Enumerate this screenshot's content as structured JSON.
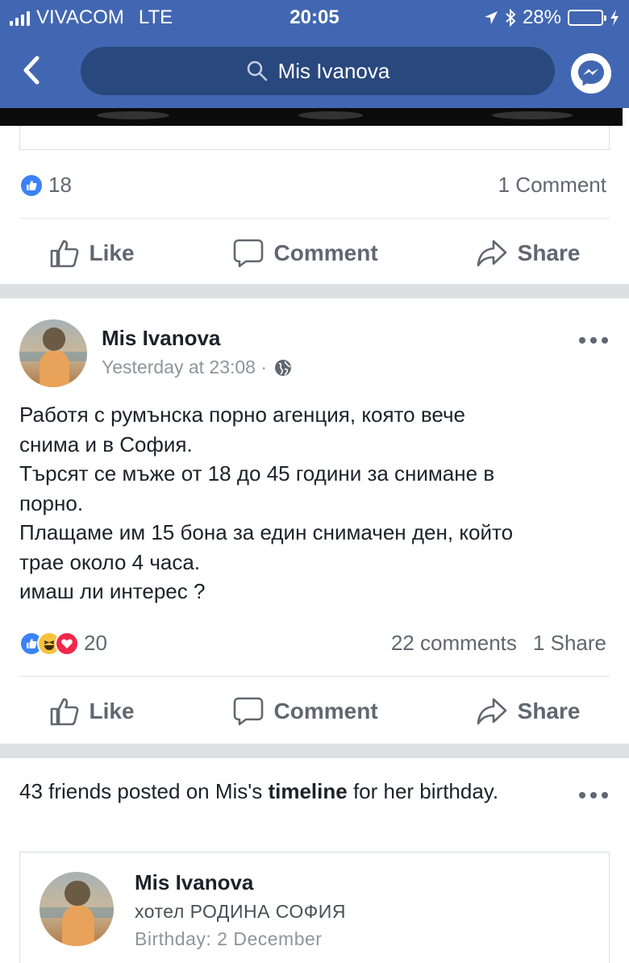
{
  "status_bar": {
    "carrier": "VIVACOM",
    "network": "LTE",
    "time": "20:05",
    "battery": "28%",
    "battery_level": 0.28
  },
  "nav": {
    "search_text": "Mis Ivanova"
  },
  "post1": {
    "reaction_count": "18",
    "comments": "1 Comment"
  },
  "actions": {
    "like": "Like",
    "comment": "Comment",
    "share": "Share"
  },
  "post2": {
    "author": "Mis Ivanova",
    "time": "Yesterday at 23:08 ·",
    "lines": [
      "Работя с румънска порно агенция, която вече",
      "снима и в София.",
      "Търсят се мъже от 18 до 45 години за снимане в",
      "порно.",
      "Плащаме им 15 бона за един снимачен ден, който",
      "трае около 4 часа.",
      "имаш ли интерес ?"
    ],
    "reaction_count": "20",
    "comments": "22 comments",
    "shares": "1 Share"
  },
  "post3": {
    "text_before": "43 friends posted on Mis's ",
    "text_bold": "timeline",
    "text_after": " for her birthday.",
    "profile_name": "Mis Ivanova",
    "profile_workplace": "хотел РОДИНА СОФИЯ",
    "profile_birthday": "Birthday: 2 December"
  },
  "colors": {
    "facebook_blue": "#4267b2",
    "search_bg": "#29487d",
    "like_blue": "#3b82f6",
    "love_red": "#f0284a",
    "haha_yellow": "#f7c23c"
  },
  "icons": [
    "back-chevron-icon",
    "search-icon",
    "messenger-icon",
    "like-thumb-icon",
    "comment-bubble-icon",
    "share-arrow-icon",
    "globe-icon",
    "more-dots-icon",
    "location-arrow-icon",
    "bluetooth-icon",
    "battery-icon",
    "charging-icon"
  ]
}
